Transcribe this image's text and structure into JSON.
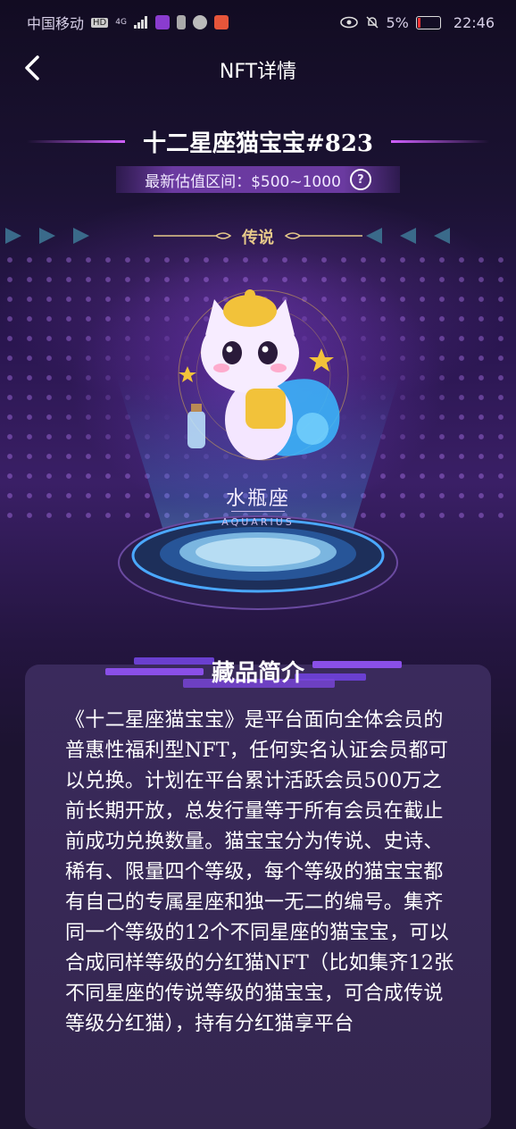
{
  "status_bar": {
    "carrier": "中国移动",
    "hd": "HD",
    "network": "4G",
    "battery": "5%",
    "time": "22:46"
  },
  "nav": {
    "title": "NFT详情",
    "back_icon": "chevron-left-icon"
  },
  "nft": {
    "title": "十二星座猫宝宝#823",
    "valuation_label": "最新估值区间：",
    "valuation_range": "$500~1000",
    "help_icon": "question-circle-icon",
    "rarity": "传说",
    "zodiac_cn": "水瓶座",
    "zodiac_en": "AQUARIUS"
  },
  "intro": {
    "heading": "藏品简介",
    "body": "《十二星座猫宝宝》是平台面向全体会员的普惠性福利型NFT，任何实名认证会员都可以兑换。计划在平台累计活跃会员500万之前长期开放，总发行量等于所有会员在截止前成功兑换数量。猫宝宝分为传说、史诗、稀有、限量四个等级，每个等级的猫宝宝都有自己的专属星座和独一无二的编号。集齐同一个等级的12个不同星座的猫宝宝，可以合成同样等级的分红猫NFT（比如集齐12张不同星座的传说等级的猫宝宝，可合成传说等级分红猫），持有分红猫享平台"
  },
  "colors": {
    "accent_purple": "#d060ff",
    "gold": "#e6c98a",
    "card_bg": "#3a2a5c",
    "beam_blue": "#5ab8ff"
  }
}
